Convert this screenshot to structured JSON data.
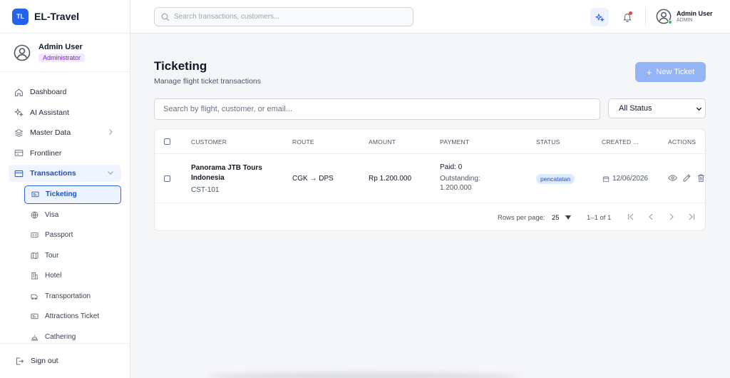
{
  "brand": {
    "logo": "TL",
    "name": "EL-Travel"
  },
  "sidebar_user": {
    "name": "Admin User",
    "role": "Administrator"
  },
  "nav": {
    "items": [
      {
        "label": "Dashboard",
        "icon": "home-icon"
      },
      {
        "label": "AI Assistant",
        "icon": "sparkle-icon"
      },
      {
        "label": "Master Data",
        "icon": "layers-icon"
      },
      {
        "label": "Frontliner",
        "icon": "card-icon"
      },
      {
        "label": "Transactions",
        "icon": "credit-card-icon"
      }
    ],
    "sub_items": [
      {
        "label": "Ticketing",
        "icon": "ticket-icon"
      },
      {
        "label": "Visa",
        "icon": "globe-icon"
      },
      {
        "label": "Passport",
        "icon": "passport-icon"
      },
      {
        "label": "Tour",
        "icon": "map-icon"
      },
      {
        "label": "Hotel",
        "icon": "building-icon"
      },
      {
        "label": "Transportation",
        "icon": "bus-icon"
      },
      {
        "label": "Attractions Ticket",
        "icon": "ticket-icon"
      },
      {
        "label": "Cathering",
        "icon": "cloche-icon"
      }
    ],
    "signout": "Sign out"
  },
  "topbar": {
    "search_placeholder": "Search transactions, customers...",
    "user_name": "Admin User",
    "user_role": "ADMIN"
  },
  "page": {
    "title": "Ticketing",
    "subtitle": "Manage flight ticket transactions",
    "new_button": "New Ticket",
    "search_placeholder": "Search by flight, customer, or email...",
    "status_filter": "All Status"
  },
  "table": {
    "headers": [
      "CUSTOMER",
      "ROUTE",
      "AMOUNT",
      "PAYMENT",
      "STATUS",
      "CREATED ...",
      "ACTIONS"
    ],
    "rows": [
      {
        "customer_name": "Panorama JTB Tours Indonesia",
        "customer_code": "CST-101",
        "route": "CGK → DPS",
        "amount": "Rp 1.200.000",
        "paid": "Paid: 0",
        "outstanding": "Outstanding: 1.200.000",
        "status": "pencatatan",
        "created": "12/06/2026"
      }
    ],
    "pager": {
      "rows_label": "Rows per page:",
      "rows_value": "25",
      "range": "1–1 of 1"
    }
  },
  "colors": {
    "accent": "#2563eb",
    "badge_bg": "#dbeafe",
    "role_badge": "#f3e8ff"
  }
}
